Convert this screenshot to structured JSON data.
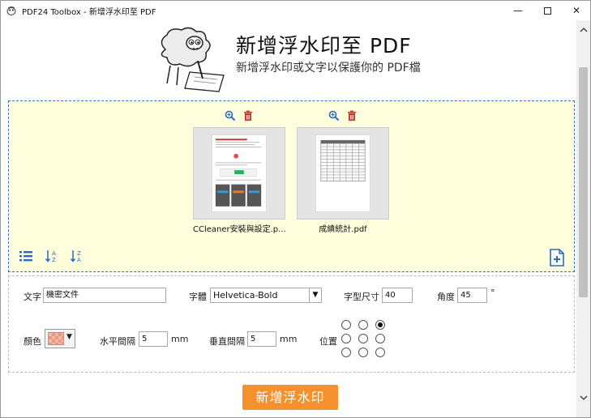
{
  "window": {
    "title": "PDF24 Toolbox - 新增浮水印至 PDF",
    "minimize": "—",
    "close": "✕"
  },
  "header": {
    "title": "新增浮水印至 PDF",
    "subtitle": "新增浮水印或文字以保護你的 PDF檔"
  },
  "files": [
    {
      "name": "CCleaner安裝與設定.p...",
      "zoom_icon": "zoom-in-icon",
      "delete_icon": "trash-icon"
    },
    {
      "name": "成績統計.pdf",
      "zoom_icon": "zoom-in-icon",
      "delete_icon": "trash-icon"
    }
  ],
  "options": {
    "text_label": "文字",
    "text_value": "機密文件",
    "font_label": "字體",
    "font_value": "Helvetica-Bold",
    "font_size_label": "字型尺寸",
    "font_size_value": "40",
    "angle_label": "角度",
    "angle_value": "45",
    "angle_unit": "°",
    "color_label": "顏色",
    "h_spacing_label": "水平間隔",
    "h_spacing_value": "5",
    "h_spacing_unit": "mm",
    "v_spacing_label": "垂直間隔",
    "v_spacing_value": "5",
    "v_spacing_unit": "mm",
    "position_label": "位置",
    "position_selected": 2
  },
  "submit_label": "新增浮水印",
  "colors": {
    "accent": "#f5912d",
    "drop_area": "#ffffdd",
    "drop_border": "#3a6fc0",
    "icon_blue": "#2a6bb8",
    "icon_red": "#c0392b"
  }
}
